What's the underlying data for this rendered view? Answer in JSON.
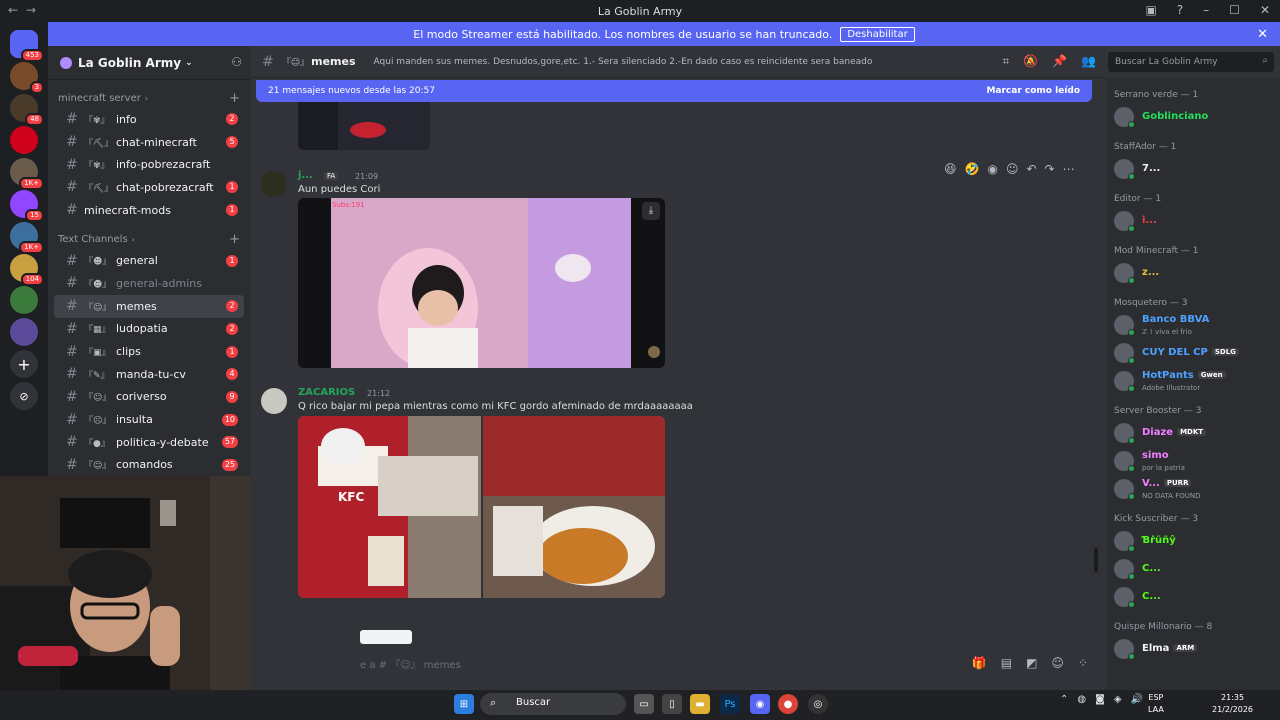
{
  "window": {
    "title": "La Goblin Army"
  },
  "banner": {
    "text": "El modo Streamer está habilitado. Los nombres de usuario se han truncado.",
    "button": "Deshabilitar"
  },
  "guilds": [
    {
      "badge": "453",
      "color": "#5865f2",
      "icon": "discord-logo-icon"
    },
    {
      "badge": "3",
      "color": "#7a4b2a",
      "icon": "guild-1-icon"
    },
    {
      "badge": "48",
      "color": "#4a3a2a",
      "icon": "guild-2-icon"
    },
    {
      "badge": "",
      "color": "#d0021b",
      "icon": "guild-3-icon"
    },
    {
      "badge": "1K+",
      "color": "#6b5b4b",
      "icon": "guild-4-icon"
    },
    {
      "badge": "15",
      "color": "#9146ff",
      "icon": "twitch-icon"
    },
    {
      "badge": "1K+",
      "color": "#3c6e9e",
      "icon": "guild-6-icon"
    },
    {
      "badge": "104",
      "color": "#c8a040",
      "icon": "guild-7-icon"
    },
    {
      "badge": "",
      "color": "#3a7a3a",
      "icon": "guild-8-icon"
    },
    {
      "badge": "",
      "color": "#5a4a9a",
      "icon": "guild-9-icon"
    }
  ],
  "sidebar": {
    "server_name": "La Goblin Army",
    "categories": [
      {
        "name": "minecraft server",
        "channels": [
          {
            "name": "info",
            "badge": "2",
            "deco": "『✾』",
            "muted": false,
            "active": false
          },
          {
            "name": "chat-minecraft",
            "badge": "5",
            "deco": "『⛏』",
            "muted": false,
            "active": false
          },
          {
            "name": "info-pobrezacraft",
            "badge": "",
            "deco": "『✾』",
            "muted": false,
            "active": false
          },
          {
            "name": "chat-pobrezacraft",
            "badge": "1",
            "deco": "『⛏』",
            "muted": false,
            "active": false
          },
          {
            "name": "minecraft-mods",
            "badge": "1",
            "deco": "",
            "muted": false,
            "active": false
          }
        ]
      },
      {
        "name": "Text Channels",
        "channels": [
          {
            "name": "general",
            "badge": "1",
            "deco": "『☻』",
            "muted": false,
            "active": false
          },
          {
            "name": "general-admins",
            "badge": "",
            "deco": "『☻』",
            "muted": true,
            "active": false
          },
          {
            "name": "memes",
            "badge": "2",
            "deco": "『☺』",
            "muted": false,
            "active": true
          },
          {
            "name": "ludopatia",
            "badge": "2",
            "deco": "『▦』",
            "muted": false,
            "active": false
          },
          {
            "name": "clips",
            "badge": "1",
            "deco": "『▣』",
            "muted": false,
            "active": false
          },
          {
            "name": "manda-tu-cv",
            "badge": "4",
            "deco": "『✎』",
            "muted": false,
            "active": false
          },
          {
            "name": "coriverso",
            "badge": "9",
            "deco": "『☺』",
            "muted": false,
            "active": false
          },
          {
            "name": "insulta",
            "badge": "10",
            "deco": "『☹』",
            "muted": false,
            "active": false
          },
          {
            "name": "politica-y-debate",
            "badge": "57",
            "deco": "『●』",
            "muted": false,
            "active": false
          },
          {
            "name": "comandos",
            "badge": "25",
            "deco": "『☺』",
            "muted": false,
            "active": false
          }
        ]
      }
    ]
  },
  "header": {
    "channel": "memes",
    "deco": "『☺』",
    "topic": "Aqui manden sus memes. Desnudos,gore,etc. 1.- Sera silenciado 2.-En dado caso es reincidente sera baneado",
    "search_placeholder": "Buscar La Goblin Army"
  },
  "new_messages": {
    "text": "21 mensajes nuevos desde las 20:57",
    "action": "Marcar como leído"
  },
  "messages": [
    {
      "author": "j...",
      "tag": "FA",
      "time": "21:09",
      "text": "Aun puedes Cori",
      "author_color": "#23a55a",
      "image_label": "Subs:191"
    },
    {
      "author": "ZACARIOS",
      "tag": "",
      "time": "21:12",
      "text": "Q rico bajar mi pepa mientras como mi KFC gordo afeminado de mrdaaaaaaaa",
      "author_color": "#23a55a",
      "image_label": "KFC"
    }
  ],
  "composer": {
    "placeholder": "e a # 『☺』 memes"
  },
  "members": {
    "groups": [
      {
        "role": "Serrano verde — 1",
        "members": [
          {
            "name": "Goblinciano",
            "sub": "",
            "tag": "",
            "color": "#23e05a"
          }
        ]
      },
      {
        "role": "StaffAdor — 1",
        "members": [
          {
            "name": "7...",
            "sub": "",
            "tag": "",
            "color": "#f2f3f5"
          }
        ]
      },
      {
        "role": "Editor — 1",
        "members": [
          {
            "name": "i...",
            "sub": "",
            "tag": "",
            "color": "#f23f43"
          }
        ]
      },
      {
        "role": "Mod Minecraft — 1",
        "members": [
          {
            "name": "z...",
            "sub": "",
            "tag": "",
            "color": "#e0c040"
          }
        ]
      },
      {
        "role": "Mosquetero — 3",
        "members": [
          {
            "name": "Banco BBVA",
            "sub": "ℤ ⌇ viva el frio",
            "tag": "",
            "color": "#4ea2ff"
          },
          {
            "name": "CUY DEL CP",
            "sub": "",
            "tag": "SDLG",
            "color": "#4ea2ff"
          },
          {
            "name": "HotPants",
            "sub": "Adobe Illustrator",
            "tag": "Gwen",
            "color": "#4ea2ff"
          }
        ]
      },
      {
        "role": "Server Booster — 3",
        "members": [
          {
            "name": "Diaze",
            "sub": "",
            "tag": "MDKT",
            "color": "#f47fff"
          },
          {
            "name": "simo",
            "sub": "por la patria",
            "tag": "",
            "color": "#f47fff"
          },
          {
            "name": "V...",
            "sub": "NO DATA FOUND",
            "tag": "PURR",
            "color": "#f47fff"
          }
        ]
      },
      {
        "role": "Kick Suscriber — 3",
        "members": [
          {
            "name": "Ɓṙüñŷ",
            "sub": "",
            "tag": "",
            "color": "#53fc18"
          },
          {
            "name": "C...",
            "sub": "",
            "tag": "",
            "color": "#53fc18"
          },
          {
            "name": "C...",
            "sub": "",
            "tag": "",
            "color": "#53fc18"
          }
        ]
      },
      {
        "role": "Quispe Millonario — 8",
        "members": [
          {
            "name": "Elma",
            "sub": "",
            "tag": "ARM",
            "color": "#f2f3f5"
          }
        ]
      }
    ]
  },
  "taskbar": {
    "search": "Buscar",
    "lang1": "ESP",
    "lang2": "LAA",
    "time": "21:35",
    "date": "21/2/2026"
  }
}
